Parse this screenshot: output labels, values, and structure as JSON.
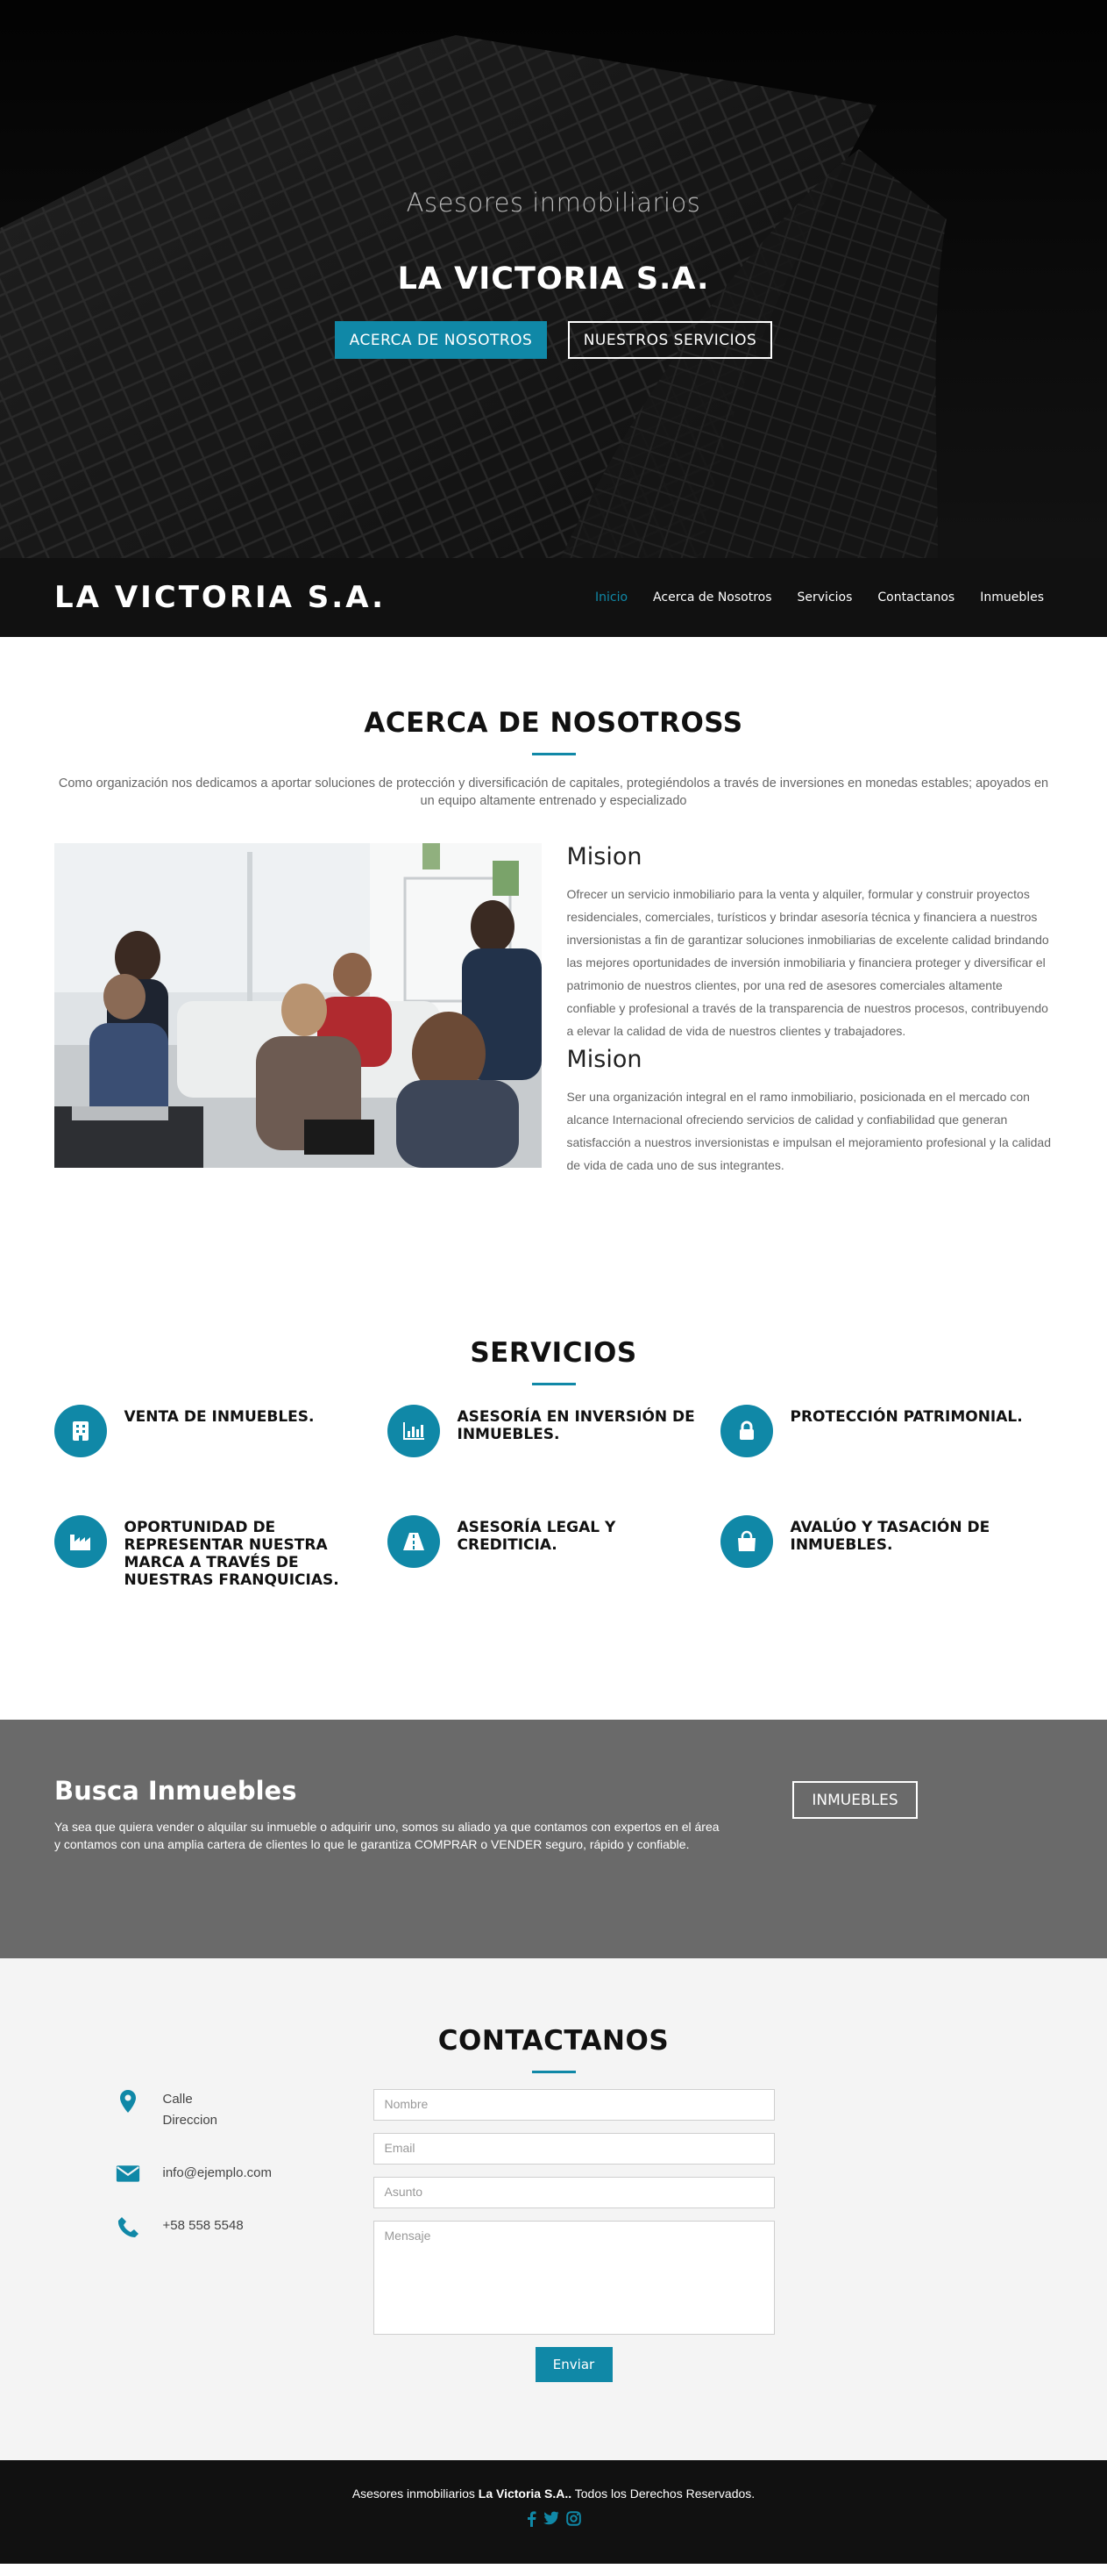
{
  "hero": {
    "subtitle": "Asesores inmobiliarios",
    "title": "LA VICTORIA S.A.",
    "btn_about": "ACERCA DE NOSOTROS",
    "btn_services": "NUESTROS SERVICIOS"
  },
  "nav": {
    "brand": "LA VICTORIA S.A.",
    "links": [
      "Inicio",
      "Acerca de Nosotros",
      "Servicios",
      "Contactanos",
      "Inmuebles"
    ],
    "active_color": "#1088a7"
  },
  "about": {
    "title": "ACERCA DE NOSOTROSS",
    "intro": "Como organización nos dedicamos a aportar soluciones de protección y diversificación de capitales, protegiéndolos a través de inversiones en monedas estables; apoyados en un equipo altamente entrenado y especializado",
    "mission1_title": "Mision",
    "mission1_text": "Ofrecer un servicio inmobiliario para la venta y alquiler, formular y construir proyectos residenciales, comerciales, turísticos y brindar asesoría técnica y financiera a nuestros inversionistas a fin de garantizar soluciones inmobiliarias de excelente calidad brindando las mejores oportunidades de inversión inmobiliaria y financiera proteger y diversificar el patrimonio de nuestros clientes, por una red de asesores comerciales altamente confiable y profesional a través de la transparencia de nuestros procesos, contribuyendo a elevar la calidad de vida de nuestros clientes y trabajadores.",
    "mission2_title": "Mision",
    "mission2_text": "Ser una organización integral en el ramo inmobiliario, posicionada en el mercado con alcance Internacional ofreciendo servicios de calidad y confiabilidad que generan satisfacción a nuestros inversionistas e impulsan el mejoramiento profesional y la calidad de vida de cada uno de sus integrantes."
  },
  "services": {
    "title": "SERVICIOS",
    "items": [
      {
        "label": "VENTA DE INMUEBLES.",
        "icon": "building-icon"
      },
      {
        "label": "ASESORÍA EN INVERSIÓN DE INMUEBLES.",
        "icon": "bar-chart-icon"
      },
      {
        "label": "PROTECCIÓN PATRIMONIAL.",
        "icon": "lock-icon"
      },
      {
        "label": "OPORTUNIDAD DE REPRESENTAR NUESTRA MARCA A TRAVÉS DE NUESTRAS FRANQUICIAS.",
        "icon": "factory-icon"
      },
      {
        "label": "ASESORÍA LEGAL Y CREDITICIA.",
        "icon": "road-icon"
      },
      {
        "label": "AVALÚO Y TASACIÓN DE INMUEBLES.",
        "icon": "shopping-bag-icon"
      }
    ]
  },
  "busca": {
    "title": "Busca Inmuebles",
    "text": "Ya sea que quiera vender o alquilar su inmueble o adquirir uno, somos su aliado ya que contamos con expertos en el área y contamos con una amplia cartera de clientes lo que le garantiza COMPRAR o VENDER seguro, rápido y confiable.",
    "button": "INMUEBLES"
  },
  "contact": {
    "title": "CONTACTANOS",
    "address_line1": "Calle",
    "address_line2": "Direccion",
    "email": "info@ejemplo.com",
    "phone": "+58 558 5548",
    "placeholders": {
      "name": "Nombre",
      "email": "Email",
      "subject": "Asunto",
      "message": "Mensaje"
    },
    "send": "Enviar"
  },
  "footer": {
    "prefix": "Asesores inmobiliarios",
    "brand": "La Victoria S.A..",
    "suffix": "Todos los Derechos Reservados."
  },
  "colors": {
    "accent": "#1088a7",
    "band": "#6a6a6a",
    "dark": "#111111"
  }
}
